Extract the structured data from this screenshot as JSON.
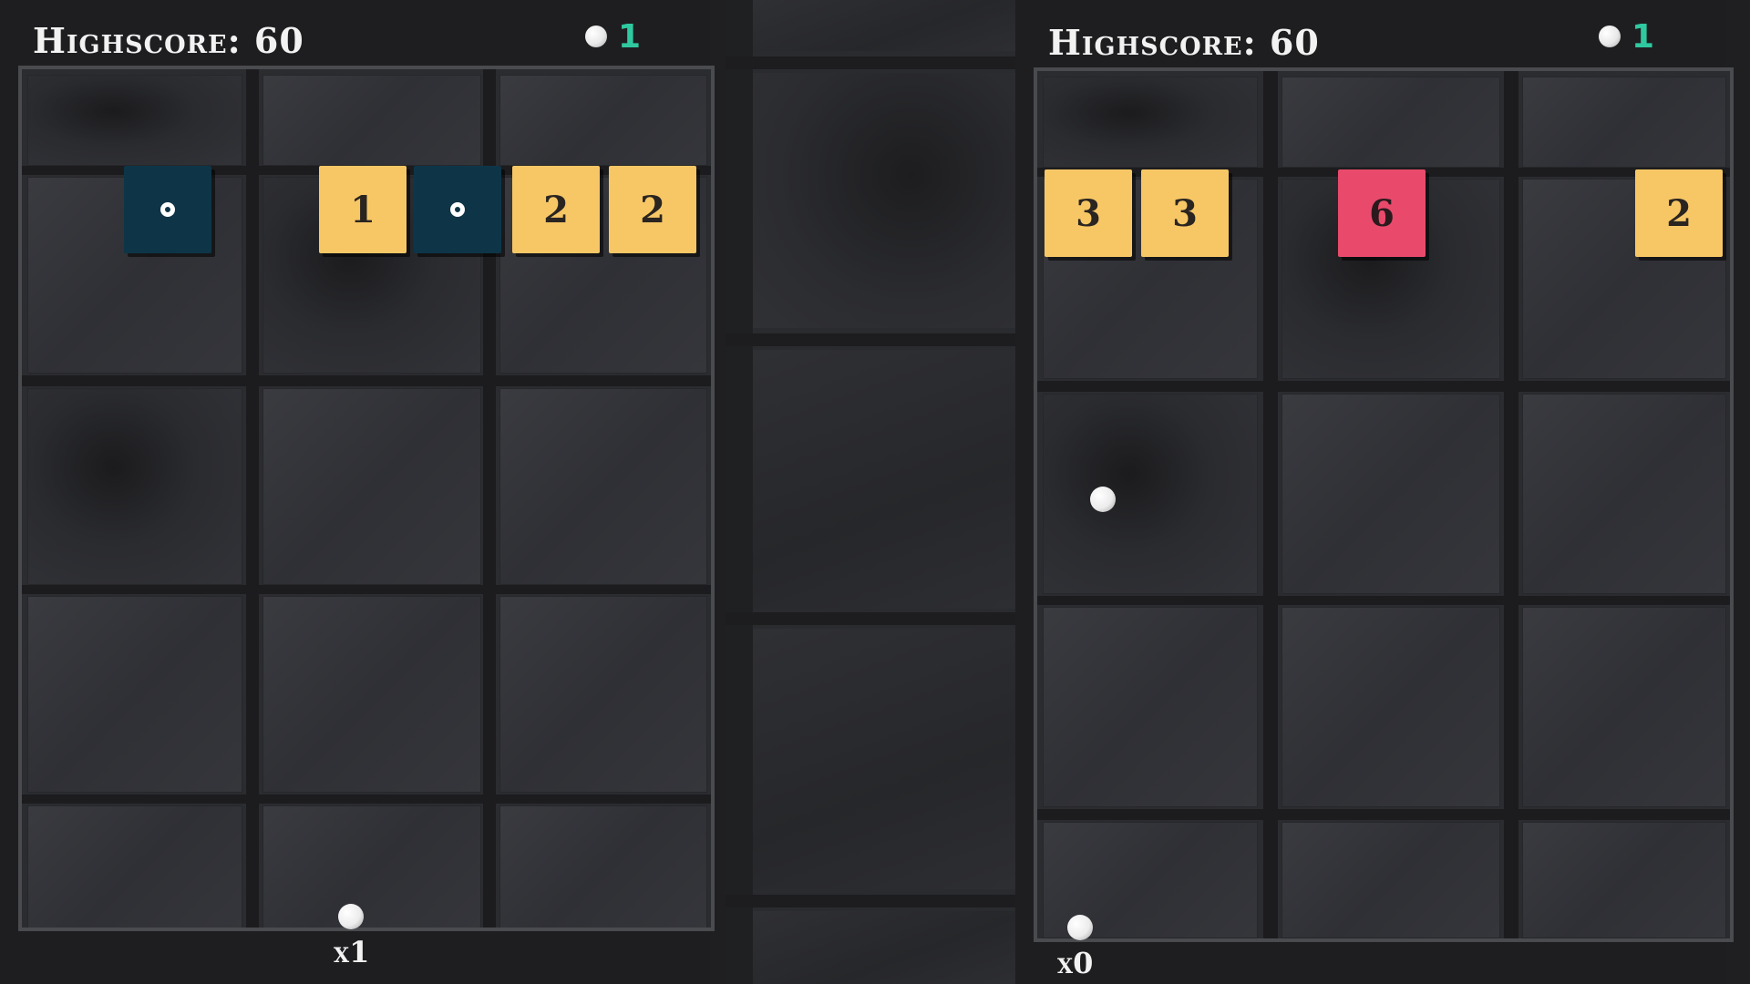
{
  "left": {
    "highscore_label": "Highscore:",
    "highscore_value": "60",
    "balls_count": "1",
    "blocks": [
      {
        "kind": "navy",
        "text": ""
      },
      {
        "kind": "yellow",
        "text": "1"
      },
      {
        "kind": "navy",
        "text": ""
      },
      {
        "kind": "yellow",
        "text": "2"
      },
      {
        "kind": "yellow",
        "text": "2"
      }
    ],
    "multiplier": "x1"
  },
  "right": {
    "highscore_label": "Highscore:",
    "highscore_value": "60",
    "balls_count": "1",
    "blocks": [
      {
        "kind": "yellow",
        "text": "3"
      },
      {
        "kind": "yellow",
        "text": "3"
      },
      {
        "kind": "pink",
        "text": "6"
      },
      {
        "kind": "yellow",
        "text": "2"
      }
    ],
    "multiplier": "x0"
  },
  "colors": {
    "yellow_block": "#f7c766",
    "pink_block": "#e94a6c",
    "navy_block": "#0e3547",
    "ball_count_accent": "#2fc9a0"
  },
  "icons": {
    "navy_block_symbol": "ring-icon",
    "ball_indicator": "ball-icon"
  }
}
